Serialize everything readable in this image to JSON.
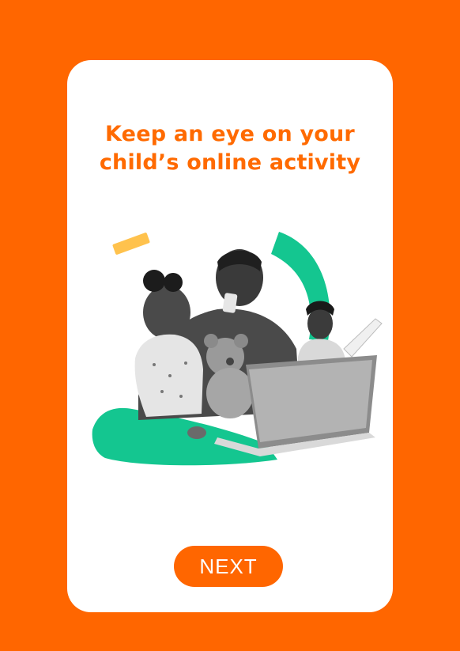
{
  "screen": {
    "background_color": "#ff6600",
    "card_color": "#ffffff"
  },
  "headline": {
    "line1": "Keep an eye on your",
    "line2": "child’s online activity",
    "color": "#ff6a00"
  },
  "illustration": {
    "accent_green": "#14c690",
    "accent_yellow": "#ffc24d"
  },
  "next_button": {
    "label": "NEXT",
    "color": "#ff6600"
  }
}
